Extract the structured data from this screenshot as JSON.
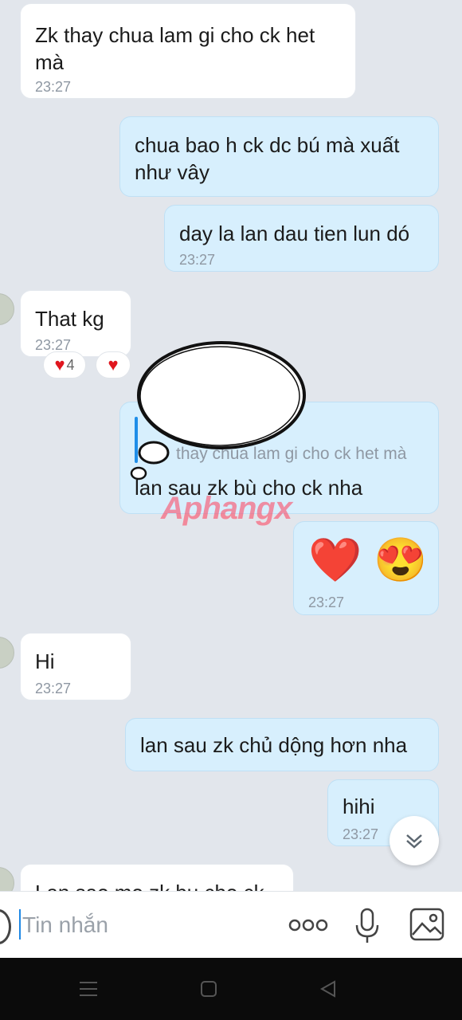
{
  "messages": [
    {
      "text": "Zk thay chua lam gi cho ck het\nmà",
      "time": "23:27"
    },
    {
      "text": "chua bao h ck dc bú mà xuất\nnhư vây"
    },
    {
      "text": "day la lan dau tien lun dó",
      "time": "23:27"
    },
    {
      "text": "That kg",
      "time": "23:27",
      "reaction_count": "4"
    },
    {
      "quote": "thay chua lam gi cho ck het mà",
      "text": "lan sau zk bù cho ck nha"
    },
    {
      "text": "❤️ 😍",
      "time": "23:27"
    },
    {
      "text": "Hi",
      "time": "23:27"
    },
    {
      "text": "lan sau zk chủ dộng hơn nha"
    },
    {
      "text": "hihi",
      "time": "23:27"
    },
    {
      "text": "Lan sao mo zk bu cho ck"
    }
  ],
  "watermark": "Aphangx",
  "input": {
    "placeholder": "Tin nhắn"
  },
  "icons": [
    "more-icon",
    "microphone-icon",
    "image-icon",
    "chevron-down-icon",
    "heart-icon",
    "menu-icon",
    "home-icon",
    "back-icon"
  ],
  "colors": {
    "sent_bubble": "#d7effd",
    "received_bubble": "#ffffff",
    "background": "#e2e6ec",
    "accent": "#1f8ee8"
  }
}
